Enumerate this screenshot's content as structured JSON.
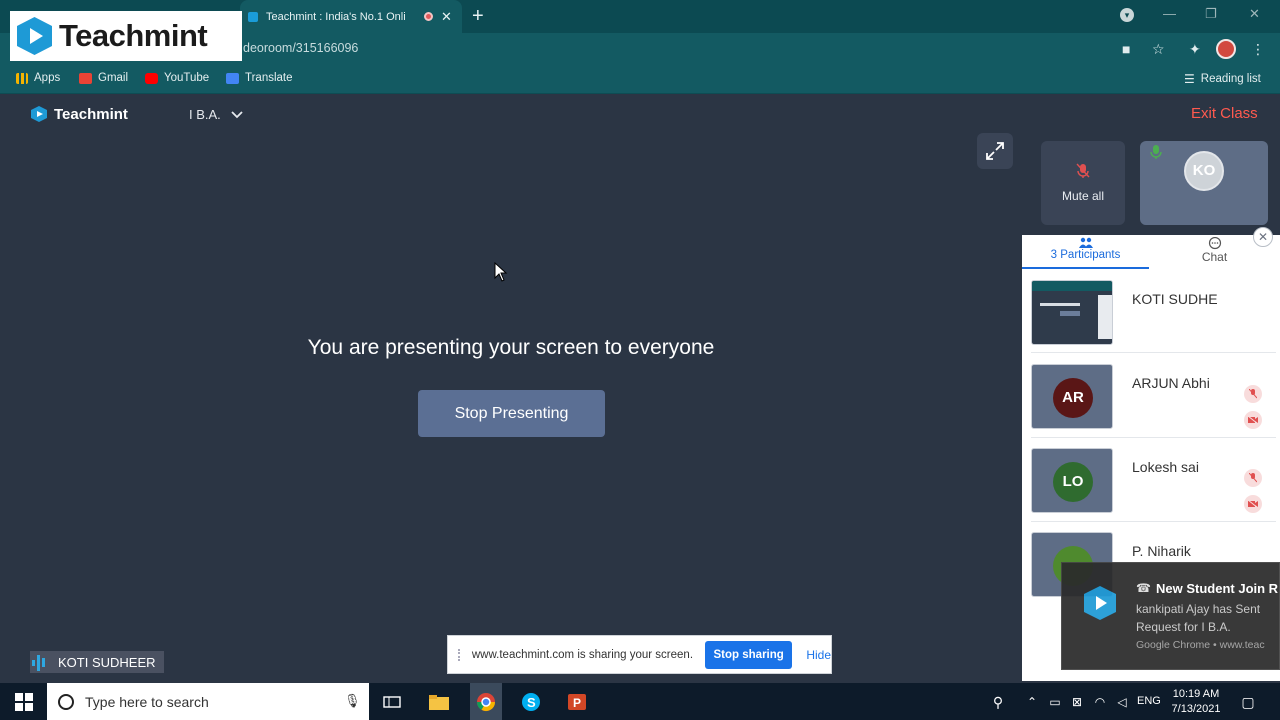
{
  "browser": {
    "tab_title": "Teachmint : India's No.1 Onli",
    "url": "deoroom/315166096",
    "bookmarks": [
      "Apps",
      "Gmail",
      "YouTube",
      "Translate"
    ],
    "reading_list": "Reading list"
  },
  "overlay_logo": {
    "text": "Teachmint"
  },
  "app": {
    "brand": "Teachmint",
    "class_name": "I B.A.",
    "exit_label": "Exit Class"
  },
  "presentation": {
    "message": "You are presenting your screen to everyone",
    "stop_label": "Stop Presenting"
  },
  "controls": {
    "mute_all": "Mute all",
    "self_initials": "KO"
  },
  "panel": {
    "participants_tab": "3 Participants",
    "chat_tab": "Chat",
    "participants": [
      {
        "name": "KOTI SUDHE",
        "initials": "",
        "color": "#ffffff"
      },
      {
        "name": "ARJUN Abhi",
        "initials": "AR",
        "color": "#5a1616"
      },
      {
        "name": "Lokesh sai",
        "initials": "LO",
        "color": "#2f6b2f"
      },
      {
        "name": "P. Niharik",
        "initials": "",
        "color": "#4f8a2e"
      }
    ]
  },
  "notification": {
    "title": "New Student Join R",
    "body": "kankipati Ajay has Sent Request for I B.A.",
    "source": "Google Chrome • www.teac"
  },
  "sharing_bar": {
    "text": "www.teachmint.com is sharing your screen.",
    "stop_label": "Stop sharing",
    "hide_label": "Hide"
  },
  "self_name": "KOTI SUDHEER",
  "taskbar": {
    "search_placeholder": "Type here to search",
    "language": "ENG",
    "time": "10:19 AM",
    "date": "7/13/2021"
  }
}
